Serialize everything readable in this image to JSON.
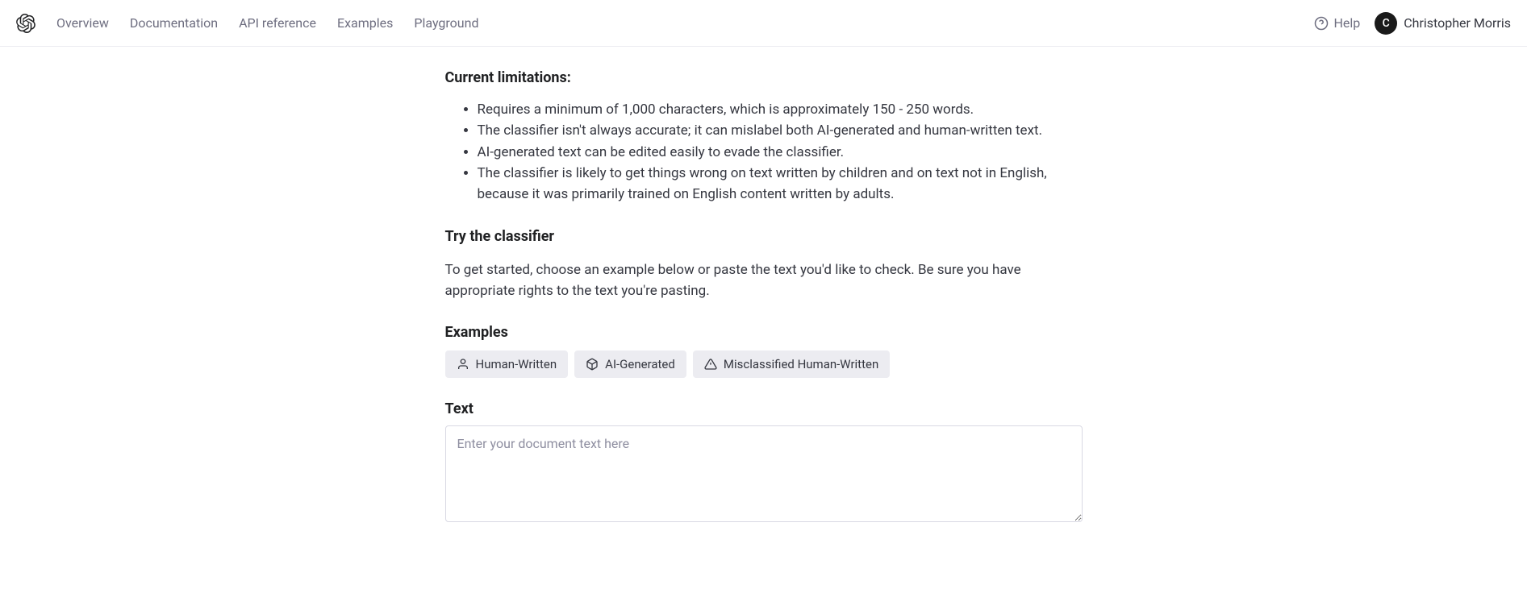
{
  "nav": {
    "items": [
      "Overview",
      "Documentation",
      "API reference",
      "Examples",
      "Playground"
    ]
  },
  "header": {
    "help_label": "Help",
    "user_initial": "C",
    "user_name": "Christopher Morris"
  },
  "content": {
    "limitations_heading": "Current limitations:",
    "limitations": [
      "Requires a minimum of 1,000 characters, which is approximately 150 - 250 words.",
      "The classifier isn't always accurate; it can mislabel both AI-generated and human-written text.",
      "AI-generated text can be edited easily to evade the classifier.",
      "The classifier is likely to get things wrong on text written by children and on text not in English, because it was primarily trained on English content written by adults."
    ],
    "try_heading": "Try the classifier",
    "intro_text": "To get started, choose an example below or paste the text you'd like to check. Be sure you have appropriate rights to the text you're pasting.",
    "examples_heading": "Examples",
    "examples": {
      "human_written": "Human-Written",
      "ai_generated": "AI-Generated",
      "misclassified": "Misclassified Human-Written"
    },
    "text_heading": "Text",
    "text_placeholder": "Enter your document text here",
    "text_value": ""
  }
}
